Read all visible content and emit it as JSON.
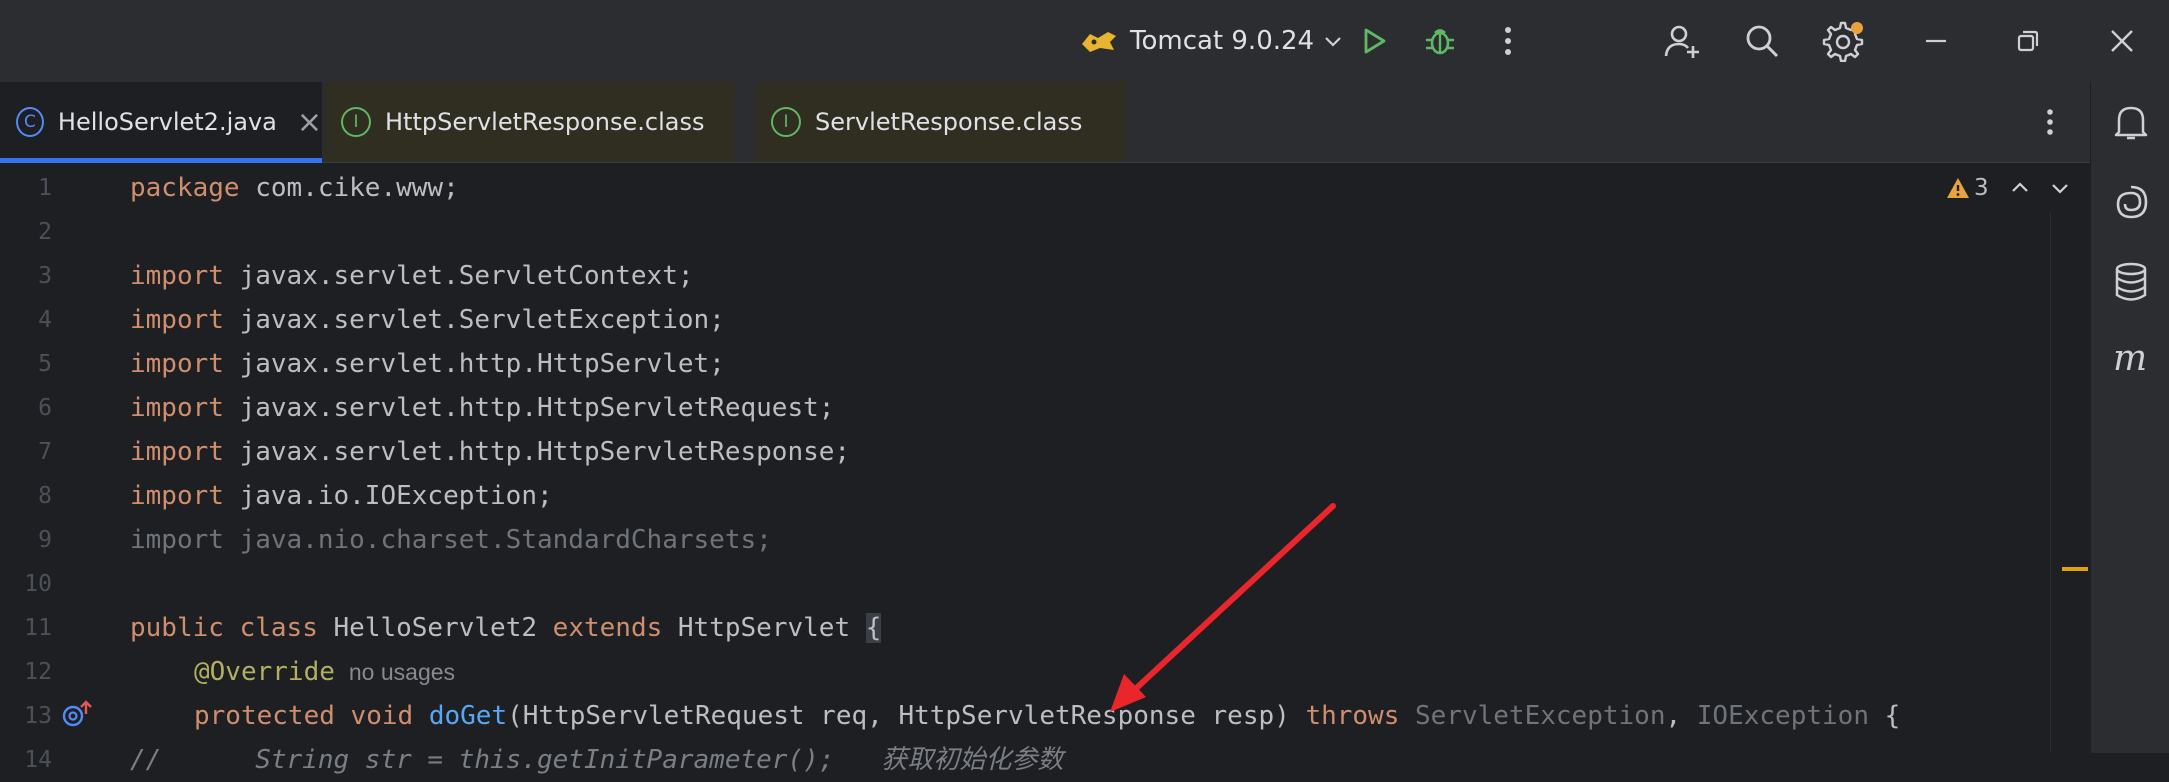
{
  "titlebar": {
    "run_config": "Tomcat 9.0.24",
    "icons": [
      "tomcat-icon",
      "chevron-down-icon",
      "run-icon",
      "debug-icon",
      "more-vertical-icon",
      "add-user-icon",
      "search-icon",
      "settings-icon",
      "minimize-icon",
      "restore-icon",
      "close-icon"
    ]
  },
  "tabs": [
    {
      "label": "HelloServlet2.java",
      "icon_letter": "C",
      "active": true,
      "close": "×"
    },
    {
      "label": "HttpServletResponse.class",
      "icon_letter": "I",
      "active": false
    },
    {
      "label": "ServletResponse.class",
      "icon_letter": "I",
      "active": false
    }
  ],
  "inspection": {
    "warnings": "3"
  },
  "gutter": {
    "line_numbers": [
      "1",
      "2",
      "3",
      "4",
      "5",
      "6",
      "7",
      "8",
      "9",
      "10",
      "11",
      "12",
      "13",
      "14"
    ]
  },
  "code": {
    "l1": {
      "kw": "package",
      "rest": " com.cike.www;"
    },
    "l3": {
      "kw": "import",
      "rest": " javax.servlet.ServletContext;"
    },
    "l4": {
      "kw": "import",
      "rest": " javax.servlet.ServletException;"
    },
    "l5": {
      "kw": "import",
      "rest": " javax.servlet.http.HttpServlet;"
    },
    "l6": {
      "kw": "import",
      "rest": " javax.servlet.http.HttpServletRequest;"
    },
    "l7": {
      "kw": "import",
      "rest": " javax.servlet.http.HttpServletResponse;"
    },
    "l8": {
      "kw": "import",
      "rest": " java.io.IOException;"
    },
    "l9": {
      "text": "import java.nio.charset.StandardCharsets;"
    },
    "l11": {
      "kw1": "public",
      "kw2": "class",
      "name": "HelloServlet2",
      "kw3": "extends",
      "parent": "HttpServlet",
      "brace": "{"
    },
    "l12": {
      "annotation": "@Override",
      "hint": "no usages"
    },
    "l13": {
      "kw1": "protected",
      "kw2": "void",
      "method": "doGet",
      "params": "(HttpServletRequest req, HttpServletResponse resp)",
      "kw3": "throws",
      "ex1": "ServletException",
      "sep": ",",
      "ex2": "IOException",
      "brace": "{"
    },
    "l14": {
      "text": "//      String str = this.getInitParameter();   获取初始化参数"
    }
  },
  "colors": {
    "accent": "#3574f0",
    "keyword": "#cf8e6d",
    "annotation": "#b3ae60",
    "method": "#56a8f5",
    "arrow": "#e8262b"
  }
}
